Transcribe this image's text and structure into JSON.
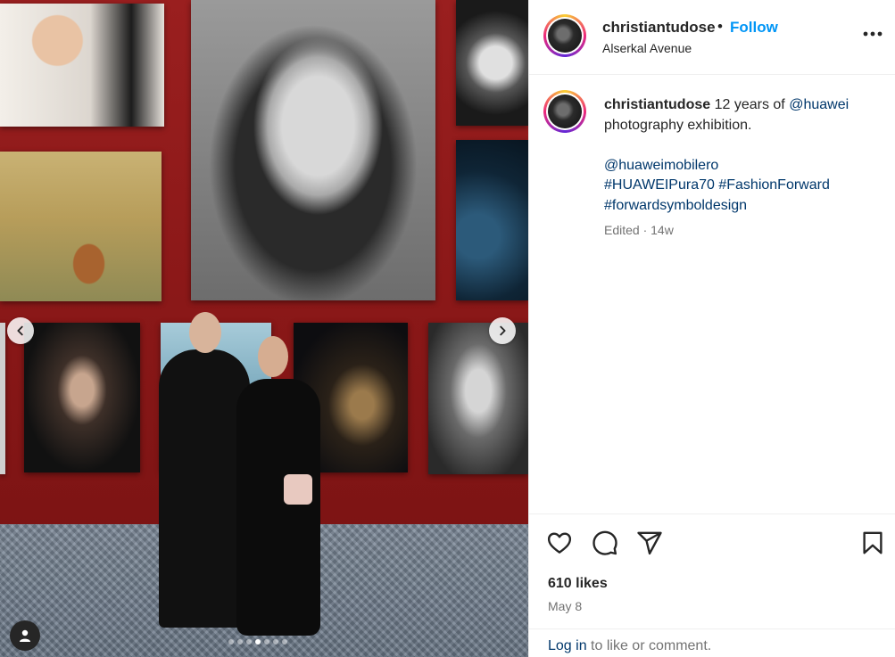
{
  "colors": {
    "follow_blue": "#0095f6",
    "link_blue": "#00376b",
    "muted": "#737373",
    "text": "#262626",
    "wall_red": "#8e1b1b"
  },
  "media": {
    "carousel_position": 1,
    "icons": {
      "prev": "chevron-left-icon",
      "next": "chevron-right-icon",
      "tag": "user-tag-icon"
    }
  },
  "header": {
    "username": "christiantudose",
    "separator": "•",
    "follow_label": "Follow",
    "location": "Alserkal Avenue",
    "more_icon": "more-horizontal-icon"
  },
  "caption": {
    "username": "christiantudose",
    "text_before": "12 years of",
    "mention_huawei": "@huawei",
    "text_after": "photography exhibition.",
    "mention_mobile": "@huaweimobilero",
    "hashtag_1": "#HUAWEIPura70",
    "hashtag_2": "#FashionForward",
    "hashtag_3": "#forwardsymboldesign",
    "meta": "Edited · 14w"
  },
  "actions": {
    "icons": [
      "heart-icon",
      "comment-icon",
      "share-icon",
      "bookmark-icon"
    ]
  },
  "likes": "610 likes",
  "date": "May 8",
  "login": {
    "link": "Log in",
    "rest": "to like or comment."
  }
}
